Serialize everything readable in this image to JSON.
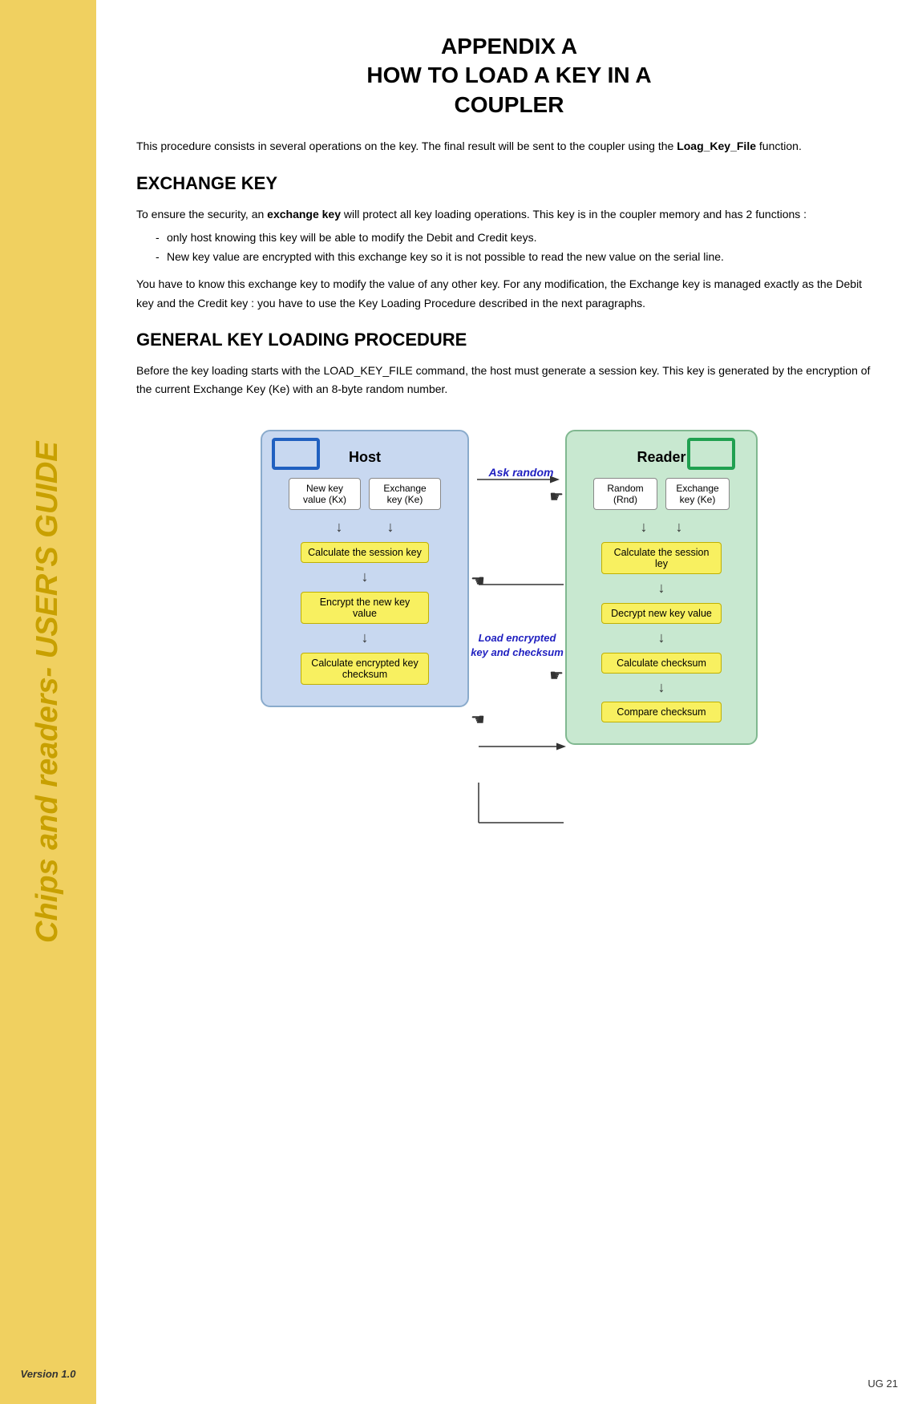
{
  "sidebar": {
    "title": "Chips and readers- USER'S GUIDE",
    "version": "Version 1.0"
  },
  "page": {
    "title_line1": "APPENDIX A",
    "title_line2": "HOW TO LOAD A KEY IN A",
    "title_line3": "COUPLER",
    "intro": "This procedure consists in several operations on the key. The final result will be sent to the coupler using the Loag_Key_File function.",
    "exchange_key_title": "EXCHANGE KEY",
    "exchange_key_body1": "To ensure the security, an exchange key will protect all key loading operations. This key is in the coupler memory and has 2 functions :",
    "exchange_key_bullet1": "only host knowing this key will be able to modify the Debit and Credit keys.",
    "exchange_key_bullet2": "New key value are encrypted with this exchange key so it is not possible to read the new value on the serial line.",
    "exchange_key_body2": "You have to know this exchange key to modify the value of any other key. For any modification, the Exchange key is managed exactly as the Debit key and the Credit key : you have to use the Key Loading Procedure described in the next paragraphs.",
    "general_title": "GENERAL KEY LOADING PROCEDURE",
    "general_body": "Before the key loading starts with the LOAD_KEY_FILE command, the host must generate a session key. This key is generated by the encryption of the current Exchange Key (Ke) with an 8-byte random number.",
    "diagram": {
      "host_label": "Host",
      "reader_label": "Reader",
      "ask_random": "Ask random",
      "load_encrypted": "Load encrypted key and checksum",
      "host_nodes": {
        "new_key": "New key value (Kx)",
        "exchange_key": "Exchange key (Ke)",
        "calc_session": "Calculate the session key",
        "encrypt_new": "Encrypt the new key value",
        "calc_checksum": "Calculate encrypted key checksum"
      },
      "reader_nodes": {
        "random": "Random (Rnd)",
        "exchange_key": "Exchange key (Ke)",
        "calc_session": "Calculate the session ley",
        "decrypt_new": "Decrypt new key value",
        "calc_checksum": "Calculate checksum",
        "compare_checksum": "Compare checksum"
      }
    }
  },
  "footer": {
    "page_number": "UG 21"
  }
}
